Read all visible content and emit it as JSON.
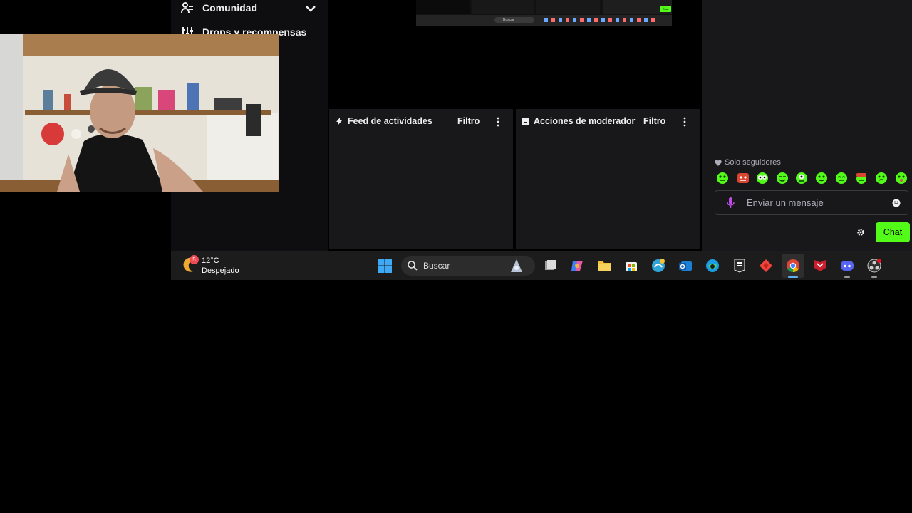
{
  "sidebar": {
    "items": [
      {
        "label": "Comunidad",
        "icon": "users-icon"
      },
      {
        "label": "Drops y recompensas",
        "icon": "drops-icon"
      }
    ]
  },
  "panels": {
    "activity": {
      "title": "Feed de actividades",
      "filter": "Filtro"
    },
    "moderator": {
      "title": "Acciones de moderador",
      "filter": "Filtro"
    }
  },
  "mini_screenshot": {
    "search_label": "Buscar",
    "chat_label": "Chat"
  },
  "chat": {
    "followers_only": "Solo seguidores",
    "input_placeholder": "Enviar un mensaje",
    "send_label": "Chat",
    "accent": "#53fc18"
  },
  "taskbar": {
    "weather": {
      "temp": "12°C",
      "desc": "Despejado",
      "badge": "5"
    },
    "search_label": "Buscar",
    "apps": [
      "task-view",
      "copilot",
      "file-explorer",
      "microsoft-store",
      "edge-dev",
      "outlook",
      "edge",
      "epic-games",
      "anydesk",
      "chrome",
      "mcafee",
      "discord",
      "obs"
    ]
  }
}
